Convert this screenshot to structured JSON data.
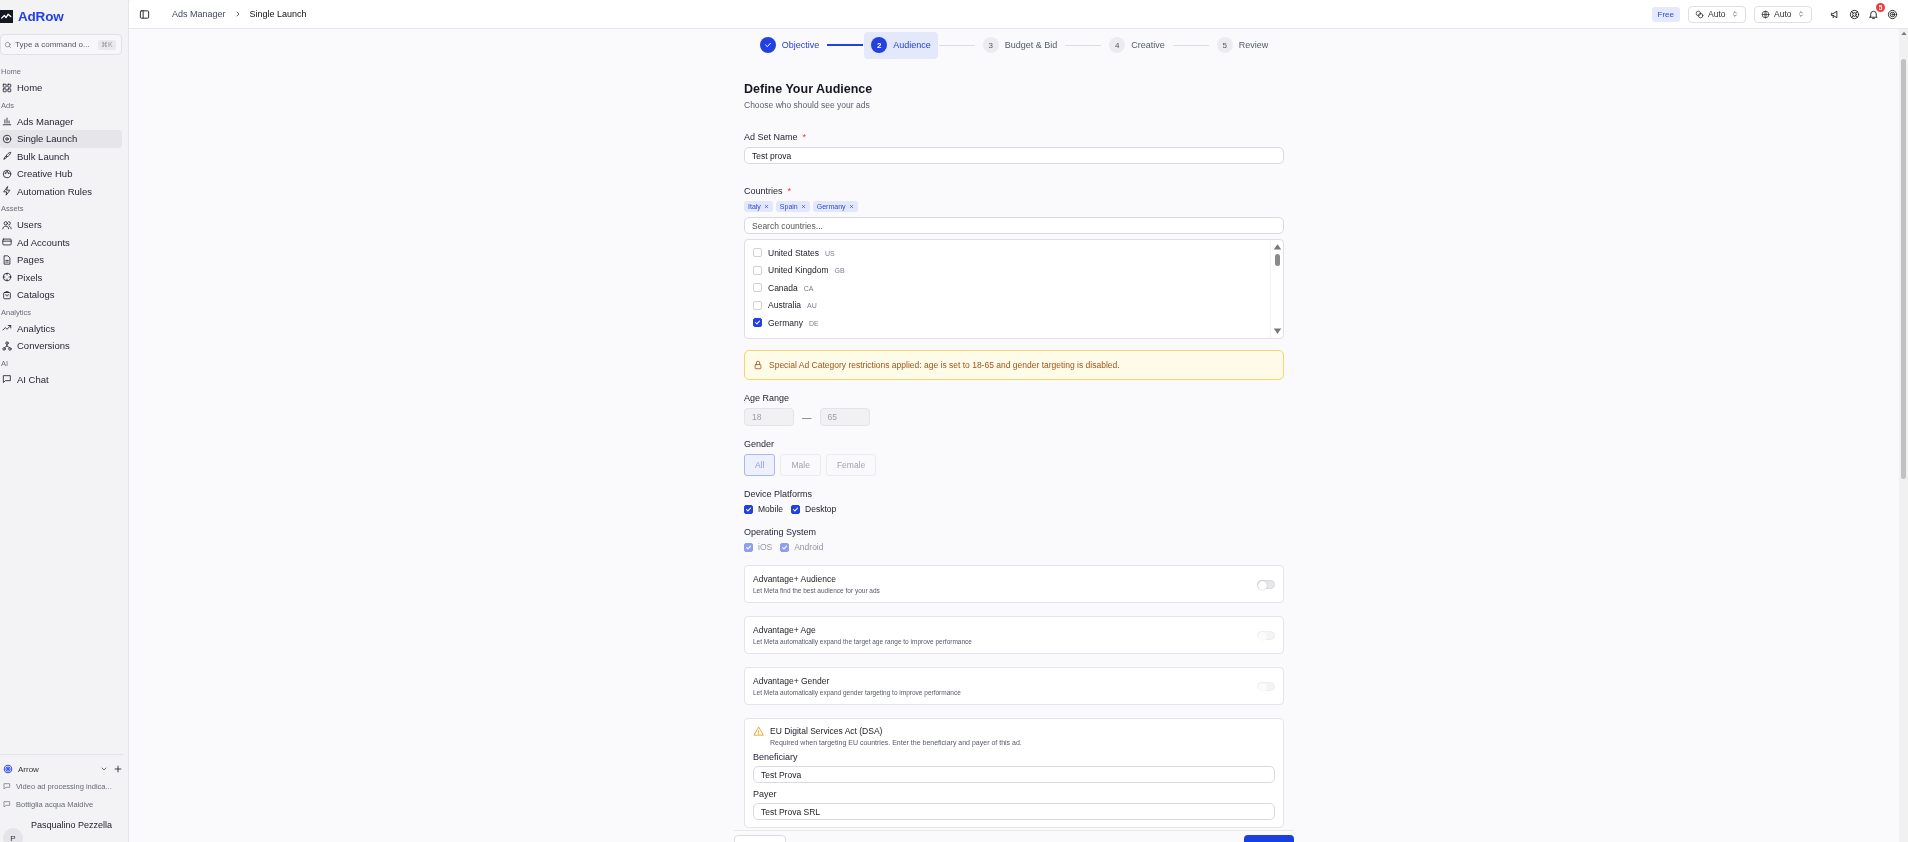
{
  "sidebar": {
    "brand": "AdRow",
    "search": {
      "placeholder": "Type a command o...",
      "shortcut": "⌘K"
    },
    "sections": [
      {
        "label": "Home",
        "items": [
          {
            "label": "Home",
            "selected": false
          }
        ]
      },
      {
        "label": "Ads",
        "items": [
          {
            "label": "Ads Manager",
            "selected": false
          },
          {
            "label": "Single Launch",
            "selected": true
          },
          {
            "label": "Bulk Launch",
            "selected": false
          },
          {
            "label": "Creative Hub",
            "selected": false
          },
          {
            "label": "Automation Rules",
            "selected": false
          }
        ]
      },
      {
        "label": "Assets",
        "items": [
          {
            "label": "Users",
            "selected": false
          },
          {
            "label": "Ad Accounts",
            "selected": false
          },
          {
            "label": "Pages",
            "selected": false
          },
          {
            "label": "Pixels",
            "selected": false
          },
          {
            "label": "Catalogs",
            "selected": false
          }
        ]
      },
      {
        "label": "Analytics",
        "items": [
          {
            "label": "Analytics",
            "selected": false
          },
          {
            "label": "Conversions",
            "selected": false
          }
        ]
      },
      {
        "label": "AI",
        "items": [
          {
            "label": "AI Chat",
            "selected": false
          }
        ]
      }
    ],
    "workspace": {
      "name": "Arrow"
    },
    "chats": [
      "Video ad processing indica...",
      "Bottiglia acqua Maldive"
    ],
    "user": {
      "initial": "P",
      "name": "Pasqualino Pezzella"
    }
  },
  "topbar": {
    "breadcrumb": [
      "Ads Manager",
      "Single Launch"
    ],
    "plan": "Free",
    "selects": [
      "Auto",
      "Auto"
    ],
    "notifications": "5"
  },
  "stepper": [
    {
      "label": "Objective",
      "completed": true,
      "selected": false
    },
    {
      "number": "2",
      "label": "Audience",
      "completed": false,
      "selected": true
    },
    {
      "number": "3",
      "label": "Budget & Bid",
      "completed": false,
      "selected": false
    },
    {
      "number": "4",
      "label": "Creative",
      "completed": false,
      "selected": false
    },
    {
      "number": "5",
      "label": "Review",
      "completed": false,
      "selected": false
    }
  ],
  "form": {
    "title": "Define Your Audience",
    "subtitle": "Choose who should see your ads",
    "ad_set_name": {
      "label": "Ad Set Name",
      "required_mark": "*",
      "value": "Test prova"
    },
    "countries": {
      "label": "Countries",
      "required_mark": "*",
      "selected": [
        "Italy",
        "Spain",
        "Germany"
      ],
      "search_placeholder": "Search countries...",
      "options": [
        {
          "name": "United States",
          "code": "US",
          "checked": false
        },
        {
          "name": "United Kingdom",
          "code": "GB",
          "checked": false
        },
        {
          "name": "Canada",
          "code": "CA",
          "checked": false
        },
        {
          "name": "Australia",
          "code": "AU",
          "checked": false
        },
        {
          "name": "Germany",
          "code": "DE",
          "checked": true
        }
      ]
    },
    "notice": "Special Ad Category restrictions applied: age is set to 18-65 and gender targeting is disabled.",
    "age_range": {
      "label": "Age Range",
      "min": "18",
      "max": "65",
      "separator": "—",
      "disabled": true
    },
    "gender": {
      "label": "Gender",
      "disabled": true,
      "options": [
        {
          "label": "All",
          "selected": true
        },
        {
          "label": "Male",
          "selected": false
        },
        {
          "label": "Female",
          "selected": false
        }
      ]
    },
    "device_platforms": {
      "label": "Device Platforms",
      "disabled": false,
      "options": [
        {
          "label": "Mobile",
          "checked": true
        },
        {
          "label": "Desktop",
          "checked": true
        }
      ]
    },
    "operating_system": {
      "label": "Operating System",
      "disabled": true,
      "options": [
        {
          "label": "iOS",
          "checked": true
        },
        {
          "label": "Android",
          "checked": true
        }
      ]
    },
    "advantage": [
      {
        "title": "Advantage+ Audience",
        "description": "Let Meta find the best audience for your ads",
        "on": false,
        "disabled": false
      },
      {
        "title": "Advantage+ Age",
        "description": "Let Meta automatically expand the target age range to improve performance",
        "on": false,
        "disabled": true
      },
      {
        "title": "Advantage+ Gender",
        "description": "Let Meta automatically expand gender targeting to improve performance",
        "on": false,
        "disabled": true
      }
    ],
    "dsa": {
      "title": "EU Digital Services Act (DSA)",
      "description": "Required when targeting EU countries. Enter the beneficiary and payer of this ad.",
      "fields": [
        {
          "label": "Beneficiary",
          "value": "Test Prova"
        },
        {
          "label": "Payer",
          "value": "Test Prova SRL"
        }
      ]
    }
  }
}
